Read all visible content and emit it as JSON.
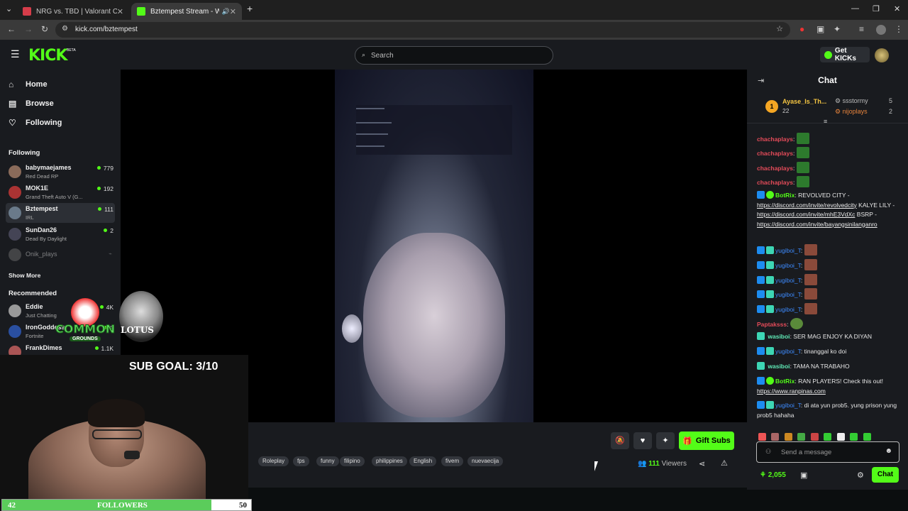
{
  "browser": {
    "tabs": [
      {
        "title": "NRG vs. TBD | Valorant Champi",
        "close": "✕"
      },
      {
        "title": "Bztempest Stream - Watch",
        "close": "✕"
      }
    ],
    "new_tab": "+",
    "url": "kick.com/bztempest"
  },
  "header": {
    "logo": "KICK",
    "beta": "BETA",
    "search_placeholder": "Search",
    "get_kicks": "Get KICKs"
  },
  "sidebar": {
    "nav": [
      {
        "label": "Home",
        "icon": "home-icon"
      },
      {
        "label": "Browse",
        "icon": "browse-icon"
      },
      {
        "label": "Following",
        "icon": "heart-icon"
      }
    ],
    "following_heading": "Following",
    "following": [
      {
        "name": "babymaejames",
        "category": "Red Dead RP",
        "viewers": "779"
      },
      {
        "name": "MOK1E",
        "category": "Grand Theft Auto V (G...",
        "viewers": "192"
      },
      {
        "name": "Bztempest",
        "category": "IRL",
        "viewers": "111"
      },
      {
        "name": "SunDan26",
        "category": "Dead By Daylight",
        "viewers": "2"
      },
      {
        "name": "Onik_plays",
        "category": "",
        "viewers": ""
      }
    ],
    "show_more": "Show More",
    "recommended_heading": "Recommended",
    "recommended": [
      {
        "name": "Eddie",
        "category": "Just Chatting",
        "viewers": "4K"
      },
      {
        "name": "IronGoddess",
        "category": "Fortnite",
        "viewers": "9"
      },
      {
        "name": "FrankDimes",
        "category": "",
        "viewers": "1.1K"
      }
    ]
  },
  "overlay": {
    "sub_goal": "SUB GOAL: 3/10",
    "followers_current": "42",
    "followers_label": "FOLLOWERS",
    "followers_goal": "50",
    "followers_progress": 0.84,
    "common": "COMMON",
    "grounds": "GROUNDS",
    "lotus": "LOTUS"
  },
  "stream": {
    "tags": [
      "Roleplay",
      "fps",
      "funny",
      "filipino",
      "philippines",
      "English",
      "fivem",
      "nuevaecija"
    ],
    "gift_subs": "Gift Subs",
    "viewers_count": "111",
    "viewers_label": "Viewers"
  },
  "chat": {
    "title": "Chat",
    "leaderboard": [
      {
        "rank": "1",
        "name": "Ayase_Is_Th...",
        "count": "22"
      },
      {
        "name": "ssstormy",
        "count": "5"
      },
      {
        "name": "nijoplays",
        "count": "2"
      }
    ],
    "messages": [
      {
        "user": "chachaplays",
        "text": ""
      },
      {
        "user": "chachaplays",
        "text": ""
      },
      {
        "user": "chachaplays",
        "text": ""
      },
      {
        "user": "chachaplays",
        "text": ""
      },
      {
        "user": "BotRix",
        "text": "REVOLVED CITY -",
        "link1": "https://discord.com/invite/revolvedcity",
        "text2": "KALYE LILY -",
        "link2": "https://discord.com/invite/mhE3VdXc",
        "text3": "BSRP -",
        "link3": "https://discord.com/invite/bayangsinilanganro"
      },
      {
        "user": "yugiboi_T",
        "text": ""
      },
      {
        "user": "yugiboi_T",
        "text": ""
      },
      {
        "user": "yugiboi_T",
        "text": ""
      },
      {
        "user": "yugiboi_T",
        "text": ""
      },
      {
        "user": "yugiboi_T",
        "text": ""
      },
      {
        "user": "Paptaksss",
        "text": ""
      },
      {
        "user": "wasiboi",
        "text": "SER MAG ENJOY KA DIYAN"
      },
      {
        "user": "yugiboi_T",
        "text": "tinanggal ko doi"
      },
      {
        "user": "wasiboi",
        "text": "TAMA NA TRABAHO"
      },
      {
        "user": "BotRix",
        "text": "RAN PLAYERS! Check this out!",
        "link1": "https://www.ranpinas.com"
      },
      {
        "user": "yugiboi_T",
        "text": "di ata yun prob5. yung prison yung prob5 hahaha"
      }
    ],
    "input_placeholder": "Send a message",
    "kicks": "2,055",
    "send_label": "Chat"
  }
}
